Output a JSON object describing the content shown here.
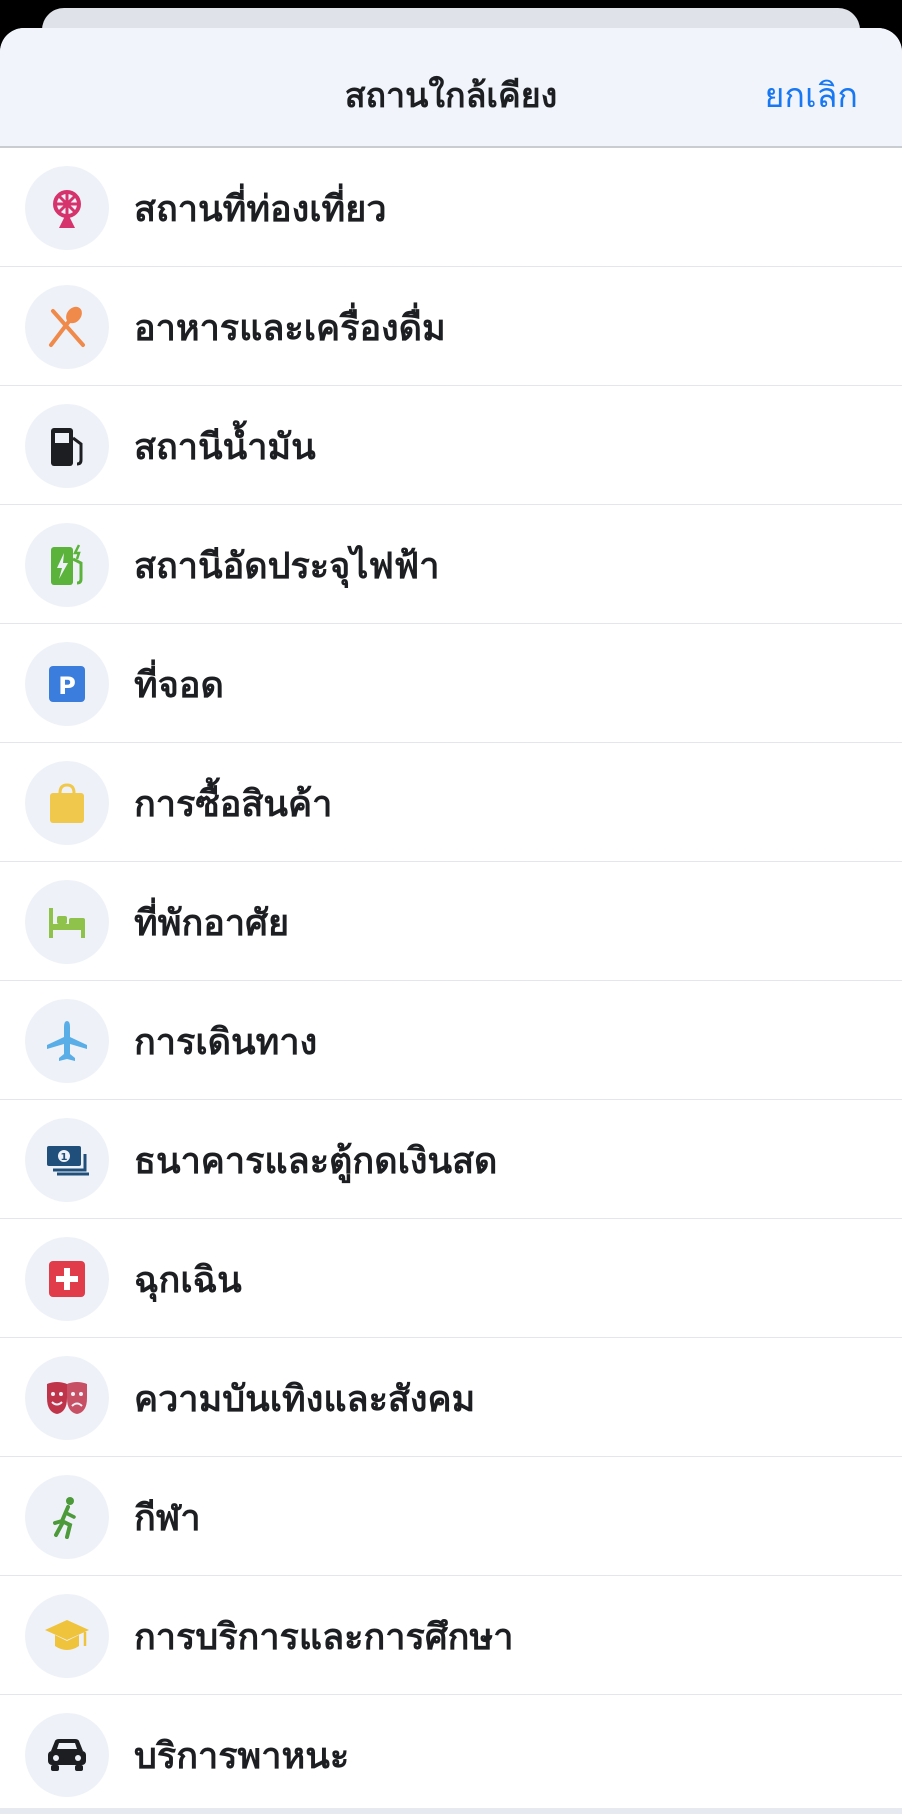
{
  "header": {
    "title": "สถานใกล้เคียง",
    "cancel_label": "ยกเลิก"
  },
  "colors": {
    "accent": "#1877f2",
    "icon_bg": "#eef2f8"
  },
  "categories": [
    {
      "label": "สถานที่ท่องเที่ยว",
      "icon": "ferris-wheel-icon",
      "color": "#d6336c"
    },
    {
      "label": "อาหารและเครื่องดื่ม",
      "icon": "fork-spoon-icon",
      "color": "#f08a4b"
    },
    {
      "label": "สถานีน้ำมัน",
      "icon": "fuel-pump-icon",
      "color": "#1c1e21"
    },
    {
      "label": "สถานีอัดประจุไฟฟ้า",
      "icon": "ev-charger-icon",
      "color": "#5bb33b"
    },
    {
      "label": "ที่จอด",
      "icon": "parking-icon",
      "color": "#3b7ddd"
    },
    {
      "label": "การซื้อสินค้า",
      "icon": "shopping-bag-icon",
      "color": "#f0c84b"
    },
    {
      "label": "ที่พักอาศัย",
      "icon": "bed-icon",
      "color": "#8ec24a"
    },
    {
      "label": "การเดินทาง",
      "icon": "airplane-icon",
      "color": "#5aaee8"
    },
    {
      "label": "ธนาคารและตู้กดเงินสด",
      "icon": "cash-icon",
      "color": "#1f4f7a"
    },
    {
      "label": "ฉุกเฉิน",
      "icon": "first-aid-icon",
      "color": "#e03c4a"
    },
    {
      "label": "ความบันเทิงและสังคม",
      "icon": "theater-masks-icon",
      "color": "#c0344a"
    },
    {
      "label": "กีฬา",
      "icon": "runner-icon",
      "color": "#4c9a3a"
    },
    {
      "label": "การบริการและการศึกษา",
      "icon": "graduation-cap-icon",
      "color": "#f0c33c"
    },
    {
      "label": "บริการพาหนะ",
      "icon": "car-icon",
      "color": "#1c1e21"
    }
  ]
}
